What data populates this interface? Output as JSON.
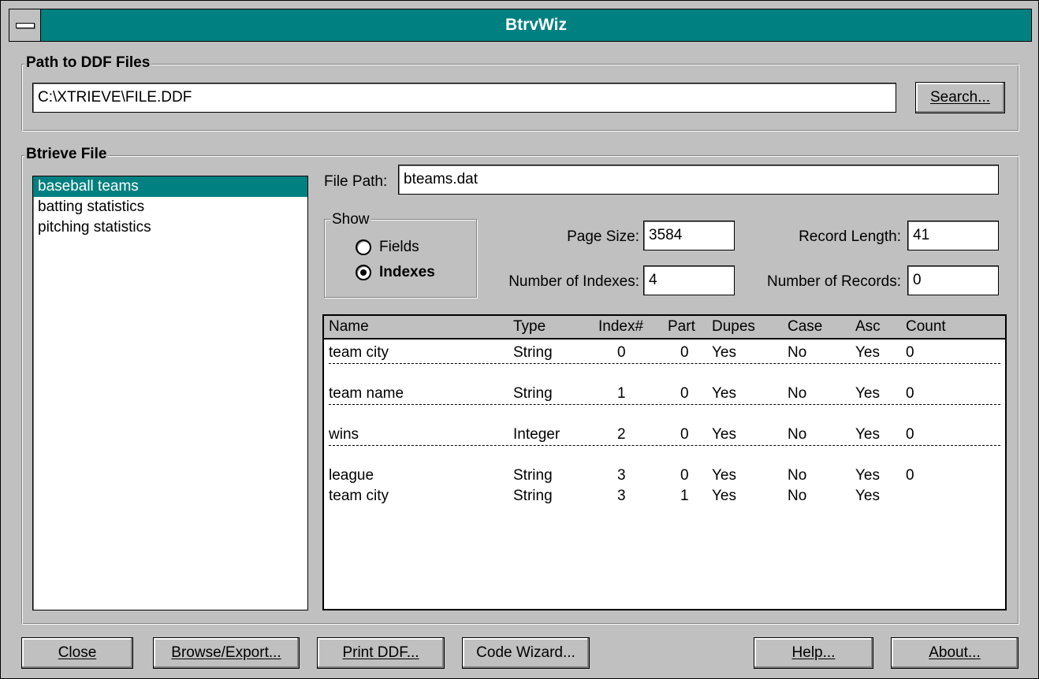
{
  "window": {
    "title": "BtrvWiz"
  },
  "path_group": {
    "label": "Path to DDF Files",
    "path_value": "C:\\XTRIEVE\\FILE.DDF",
    "search_button": "Search..."
  },
  "btrieve_group": {
    "label": "Btrieve File",
    "files": [
      "baseball teams",
      "batting statistics",
      "pitching statistics"
    ],
    "selected_file": "baseball teams",
    "file_path_label": "File Path:",
    "file_path_value": "bteams.dat",
    "show": {
      "label": "Show",
      "options": [
        "Fields",
        "Indexes"
      ],
      "selected": "Indexes"
    },
    "page_size_label": "Page Size:",
    "page_size_value": "3584",
    "record_length_label": "Record Length:",
    "record_length_value": "41",
    "num_indexes_label": "Number of Indexes:",
    "num_indexes_value": "4",
    "num_records_label": "Number of Records:",
    "num_records_value": "0"
  },
  "index_table": {
    "columns": [
      "Name",
      "Type",
      "Index#",
      "Part",
      "Dupes",
      "Case",
      "Asc",
      "Count"
    ],
    "groups": [
      [
        [
          "team city",
          "String",
          "0",
          "0",
          "Yes",
          "No",
          "Yes",
          "0"
        ]
      ],
      [
        [
          "team name",
          "String",
          "1",
          "0",
          "Yes",
          "No",
          "Yes",
          "0"
        ]
      ],
      [
        [
          "wins",
          "Integer",
          "2",
          "0",
          "Yes",
          "No",
          "Yes",
          "0"
        ]
      ],
      [
        [
          "league",
          "String",
          "3",
          "0",
          "Yes",
          "No",
          "Yes",
          "0"
        ],
        [
          "team city",
          "String",
          "3",
          "1",
          "Yes",
          "No",
          "Yes",
          ""
        ]
      ]
    ]
  },
  "buttons": {
    "close": "Close",
    "browse_export": "Browse/Export...",
    "print_ddf": "Print DDF...",
    "code_wizard": "Code Wizard...",
    "help": "Help...",
    "about": "About..."
  },
  "colors": {
    "titlebar": "#008080",
    "selection": "#008080",
    "face": "#c0c0c0"
  },
  "icons": {
    "system_menu": "system-menu-icon"
  }
}
